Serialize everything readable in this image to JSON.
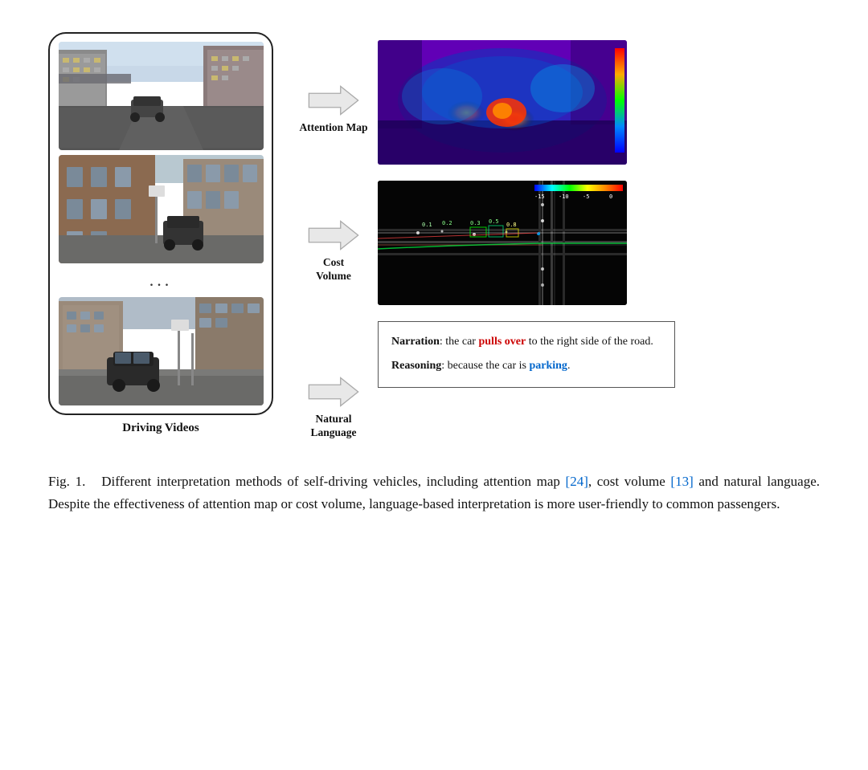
{
  "diagram": {
    "driving_videos_label": "Driving Videos",
    "dots": "...",
    "arrow1_label": "Attention\nMap",
    "arrow2_label": "Cost\nVolume",
    "arrow3_label": "Natural\nLanguage",
    "narration_label": "Narration",
    "narration_text1": ": the car ",
    "narration_highlight": "pulls over",
    "narration_text2": " to the right side of the road.",
    "reasoning_label": "Reasoning",
    "reasoning_text1": ": because the car is ",
    "reasoning_highlight": "parking",
    "reasoning_end": "."
  },
  "caption": {
    "fig_label": "Fig. 1.",
    "text": "    Different interpretation methods of self-driving vehicles, including attention map [24], cost volume [13] and natural language. Despite the effectiveness of attention map or cost volume, language-based interpretation is more user-friendly to common passengers.",
    "ref1": "[24]",
    "ref2": "[13]"
  }
}
